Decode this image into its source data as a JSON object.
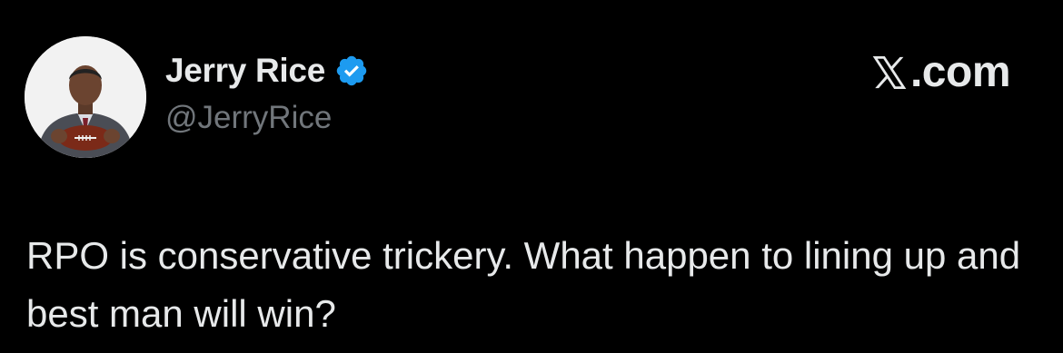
{
  "author": {
    "display_name": "Jerry Rice",
    "handle": "@JerryRice",
    "verified_icon": "verified-badge-icon",
    "verified_color": "#1d9bf0",
    "avatar_icon": "profile-photo-avatar"
  },
  "brand": {
    "icon": "x-logo-icon",
    "text": ".com"
  },
  "tweet": {
    "text": "RPO is conservative trickery. What happen to lining up and best man will win?"
  },
  "colors": {
    "background": "#000000",
    "primary_text": "#e7e9ea",
    "secondary_text": "#71767b"
  }
}
